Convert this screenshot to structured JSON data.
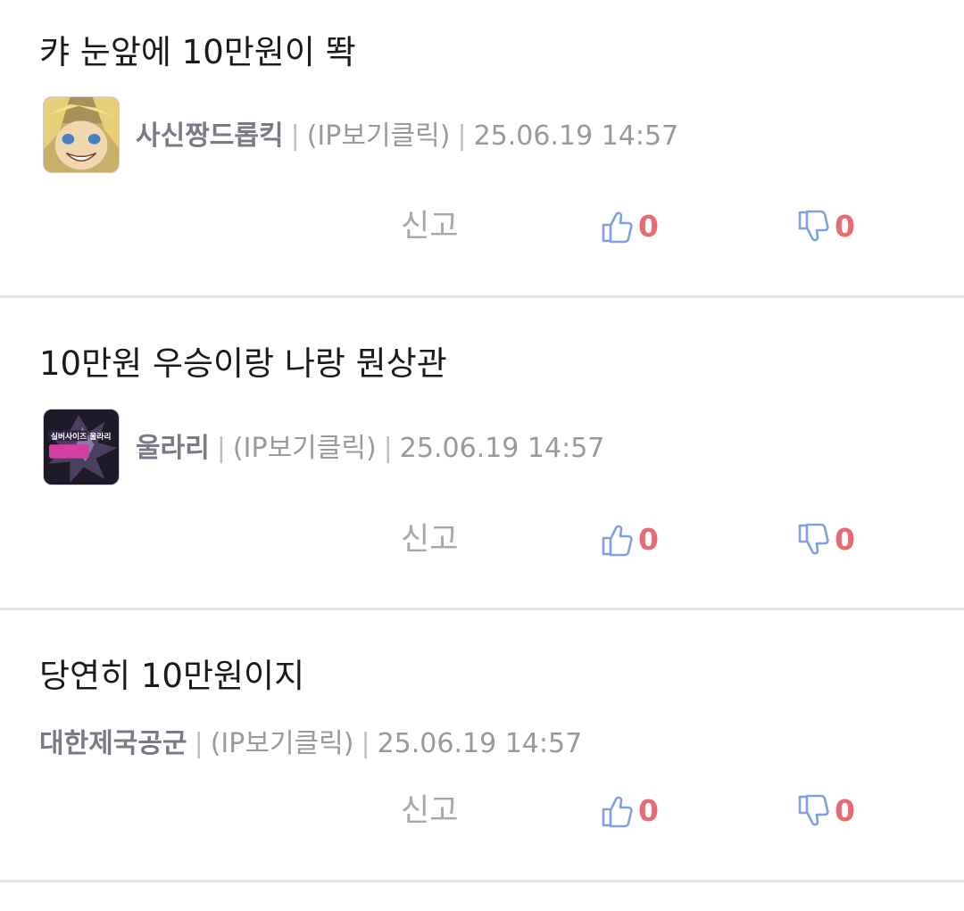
{
  "comments": [
    {
      "text": "캬 눈앞에 10만원이 똭",
      "nickname": "사신짱드롭킥",
      "ip": "(IP보기클릭)",
      "date": "25.06.19 14:57",
      "report": "신고",
      "likes": "0",
      "dislikes": "0",
      "has_avatar": true
    },
    {
      "text": "10만원 우승이랑 나랑 뭔상관",
      "nickname": "울라리",
      "ip": "(IP보기클릭)",
      "date": "25.06.19 14:57",
      "report": "신고",
      "likes": "0",
      "dislikes": "0",
      "has_avatar": true,
      "avatar_text": "실버사이즈 울라리"
    },
    {
      "text": "당연히 10만원이지",
      "nickname": "대한제국공군",
      "ip": "(IP보기클릭)",
      "date": "25.06.19 14:57",
      "report": "신고",
      "likes": "0",
      "dislikes": "0",
      "has_avatar": false
    }
  ],
  "separator": "|",
  "colors": {
    "like_icon": "#7ea2e0",
    "dislike_icon": "#7ea2e0",
    "count": "#e86b74",
    "nickname": "#7a7a86",
    "meta": "#9a9a9a",
    "divider": "#e3e3e3"
  },
  "icons": {
    "like": "thumbs-up-icon",
    "dislike": "thumbs-down-icon"
  }
}
